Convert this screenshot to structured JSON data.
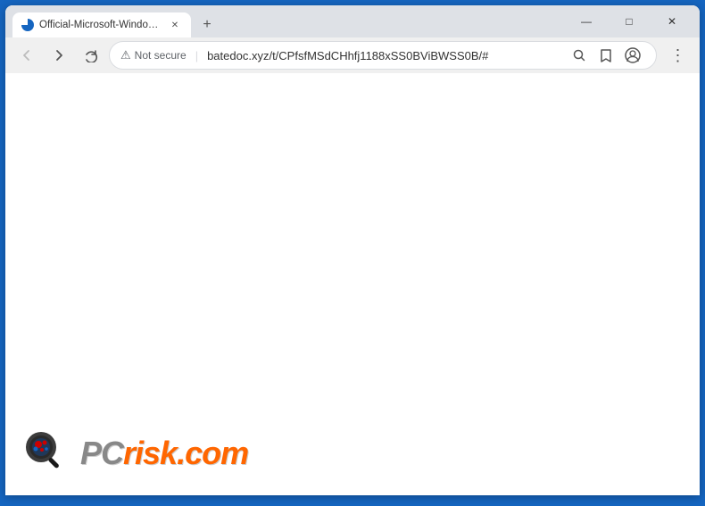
{
  "window": {
    "title": "Official-Microsoft-Windows-Help",
    "tab_label": "Official-Microsoft-Windows-Help",
    "url": "batedoc.xyz/t/CPfsfMSdCHhfj1188xSS0BViBWSS0B/#",
    "not_secure": "Not secure",
    "new_tab_tooltip": "New tab"
  },
  "nav": {
    "back_label": "←",
    "forward_label": "→",
    "reload_label": "✕",
    "search_icon": "🔍",
    "star_icon": "☆",
    "profile_icon": "👤",
    "more_icon": "⋮"
  },
  "window_controls": {
    "minimize": "—",
    "maximize": "□",
    "close": "✕"
  },
  "watermark": {
    "pc_text": "PC",
    "risk_text": "risk.com"
  }
}
